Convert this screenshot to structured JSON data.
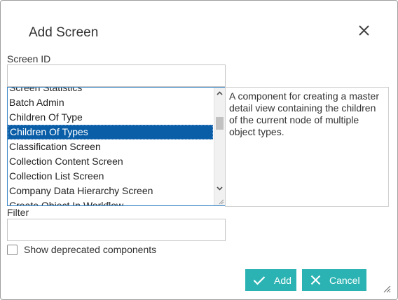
{
  "dialog": {
    "title": "Add Screen"
  },
  "screen_id": {
    "label": "Screen ID",
    "value": ""
  },
  "component_list": {
    "items": [
      "Screen Statistics",
      "Batch Admin",
      "Children Of Type",
      "Children Of Types",
      "Classification Screen",
      "Collection Content Screen",
      "Collection List Screen",
      "Company Data Hierarchy Screen",
      "Create Object In Workflow"
    ],
    "selected": "Children Of Types"
  },
  "description": {
    "text": "A component for creating a master detail view containing the children of the current node of multiple object types."
  },
  "filter": {
    "label": "Filter",
    "value": ""
  },
  "deprecated": {
    "label": "Show deprecated components",
    "checked": false
  },
  "buttons": {
    "add_label": "Add",
    "cancel_label": "Cancel"
  },
  "colors": {
    "accent": "#2bb3b3",
    "selection": "#0a5ea8",
    "list_border": "#3b86c4"
  },
  "icons": {
    "close": "close-icon",
    "add": "check-icon",
    "cancel": "x-icon"
  }
}
